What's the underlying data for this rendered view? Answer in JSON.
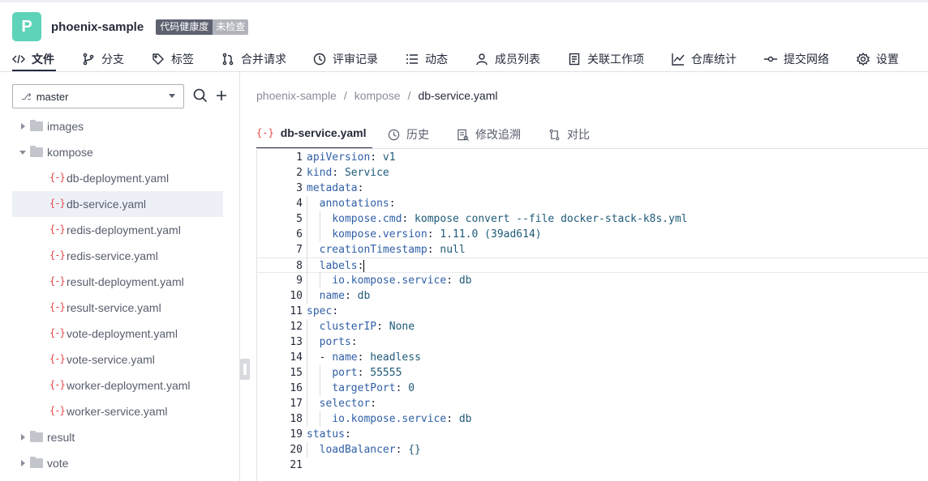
{
  "project": {
    "logo_letter": "P",
    "name": "phoenix-sample",
    "health_label": "代码健康度",
    "health_status": "未检查"
  },
  "nav": {
    "items": [
      {
        "label": "文件",
        "icon": "code-icon"
      },
      {
        "label": "分支",
        "icon": "branch-icon"
      },
      {
        "label": "标签",
        "icon": "tag-icon"
      },
      {
        "label": "合并请求",
        "icon": "merge-request-icon"
      },
      {
        "label": "评审记录",
        "icon": "review-history-icon"
      },
      {
        "label": "动态",
        "icon": "activity-list-icon"
      },
      {
        "label": "成员列表",
        "icon": "members-icon"
      },
      {
        "label": "关联工作项",
        "icon": "work-item-icon"
      },
      {
        "label": "仓库统计",
        "icon": "stats-chart-icon"
      },
      {
        "label": "提交网络",
        "icon": "commit-network-icon"
      },
      {
        "label": "设置",
        "icon": "gear-icon"
      }
    ]
  },
  "sidebar": {
    "branch": "master",
    "tree": [
      {
        "type": "folder",
        "name": "images",
        "expanded": false
      },
      {
        "type": "folder",
        "name": "kompose",
        "expanded": true
      },
      {
        "type": "file",
        "name": "db-deployment.yaml"
      },
      {
        "type": "file",
        "name": "db-service.yaml",
        "selected": true
      },
      {
        "type": "file",
        "name": "redis-deployment.yaml"
      },
      {
        "type": "file",
        "name": "redis-service.yaml"
      },
      {
        "type": "file",
        "name": "result-deployment.yaml"
      },
      {
        "type": "file",
        "name": "result-service.yaml"
      },
      {
        "type": "file",
        "name": "vote-deployment.yaml"
      },
      {
        "type": "file",
        "name": "vote-service.yaml"
      },
      {
        "type": "file",
        "name": "worker-deployment.yaml"
      },
      {
        "type": "file",
        "name": "worker-service.yaml"
      },
      {
        "type": "folder",
        "name": "result",
        "expanded": false
      },
      {
        "type": "folder",
        "name": "vote",
        "expanded": false
      }
    ]
  },
  "breadcrumb": [
    "phoenix-sample",
    "kompose",
    "db-service.yaml"
  ],
  "file_tabs": [
    {
      "label": "db-service.yaml",
      "icon": "yaml-file-icon"
    },
    {
      "label": "历史",
      "icon": "history-icon"
    },
    {
      "label": "修改追溯",
      "icon": "blame-icon"
    },
    {
      "label": "对比",
      "icon": "compare-icon"
    }
  ],
  "code": {
    "active_line": 8,
    "lines": [
      "apiVersion: v1",
      "kind: Service",
      "metadata:",
      "  annotations:",
      "    kompose.cmd: kompose convert --file docker-stack-k8s.yml",
      "    kompose.version: 1.11.0 (39ad614)",
      "  creationTimestamp: null",
      "  labels:",
      "    io.kompose.service: db",
      "  name: db",
      "spec:",
      "  clusterIP: None",
      "  ports:",
      "  - name: headless",
      "    port: 55555",
      "    targetPort: 0",
      "  selector:",
      "    io.kompose.service: db",
      "status:",
      "  loadBalancer: {}",
      ""
    ]
  }
}
